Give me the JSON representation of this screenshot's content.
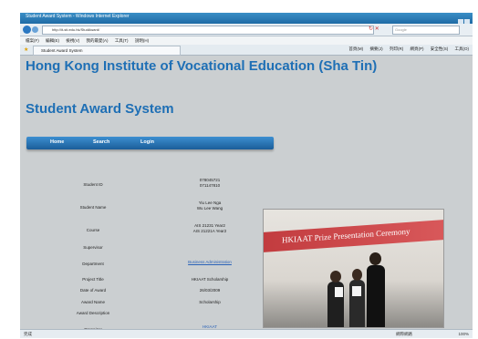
{
  "window": {
    "title": "Student Award System - Windows Internet Explorer"
  },
  "addressbar": {
    "url": "http://it-sti.edu.hk/StudAward/",
    "search_placeholder": "Google"
  },
  "menu": [
    "檔案(F)",
    "編輯(E)",
    "檢視(V)",
    "我的最愛(A)",
    "工具(T)",
    "說明(H)"
  ],
  "tab": {
    "label": "Student Award System"
  },
  "toolbar": [
    "首頁(M)",
    "摘要(J)",
    "列印(R)",
    "網頁(P)",
    "安全性(S)",
    "工具(O)"
  ],
  "page": {
    "title": "Hong Kong Institute of Vocational Education (Sha Tin)",
    "subtitle": "Student Award System",
    "nav": [
      "Home",
      "Search",
      "Login"
    ]
  },
  "record": {
    "fields": [
      {
        "label": "Student ID",
        "value": "078045721\n071147810"
      },
      {
        "label": "Student Name",
        "value": "Yiu Lee Nga\nWu Lee Wang"
      },
      {
        "label": "Course",
        "value": "AIS 21231 Year2\nAIS 21221A Year2"
      },
      {
        "label": "Supervisor",
        "value": ""
      },
      {
        "label": "Department",
        "value": "Business Administration"
      },
      {
        "label": "Project Title",
        "value": "HKIAAT Scholarship"
      },
      {
        "label": "Date of Award",
        "value": "26/03/2009"
      },
      {
        "label": "Award Name",
        "value": "Scholarship"
      },
      {
        "label": "Award Description",
        "value": ""
      },
      {
        "label": "Organizer",
        "value": "HKIAAT"
      }
    ]
  },
  "photo": {
    "banner_text": "HKIAAT Prize Presentation Ceremony"
  },
  "statusbar": {
    "left": "完成",
    "zone": "網際網路",
    "zoom": "100%"
  }
}
